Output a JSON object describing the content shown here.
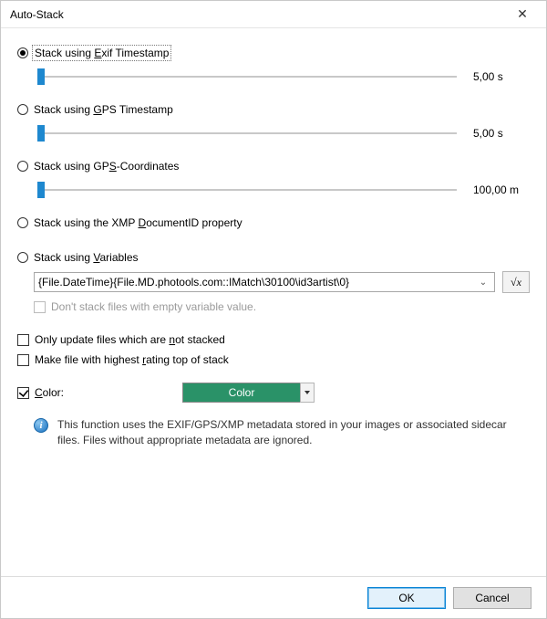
{
  "title": "Auto-Stack",
  "options": {
    "exif": {
      "label_pre": "Stack using ",
      "accel": "E",
      "label_post": "xif Timestamp",
      "value": "5,00 s"
    },
    "gpsTs": {
      "label_pre": "Stack using ",
      "accel": "G",
      "label_post": "PS Timestamp",
      "value": "5,00 s"
    },
    "gpsCo": {
      "label_pre": "Stack using GP",
      "accel": "S",
      "label_post": "-Coordinates",
      "value": "100,00 m"
    },
    "xmp": {
      "label_pre": "Stack using the XMP ",
      "accel": "D",
      "label_post": "ocumentID property"
    },
    "vars": {
      "label_pre": "Stack using ",
      "accel": "V",
      "label_post": "ariables"
    }
  },
  "variableExpr": "{File.DateTime}{File.MD.photools.com::IMatch\\30100\\id3artist\\0}",
  "formulaBtn": "√x",
  "check": {
    "noEmpty": "Don't stack files with empty variable value.",
    "onlyNot_pre": "Only update files which are ",
    "onlyNot_accel": "n",
    "onlyNot_post": "ot stacked",
    "rating_pre": "Make file with highest ",
    "rating_accel": "r",
    "rating_post": "ating top of stack",
    "color_accel": "C",
    "color_post": "olor:"
  },
  "colorChip": "Color",
  "info": "This function uses the EXIF/GPS/XMP metadata stored in your images or associated sidecar files. Files without appropriate metadata are ignored.",
  "buttons": {
    "ok": "OK",
    "cancel": "Cancel"
  }
}
